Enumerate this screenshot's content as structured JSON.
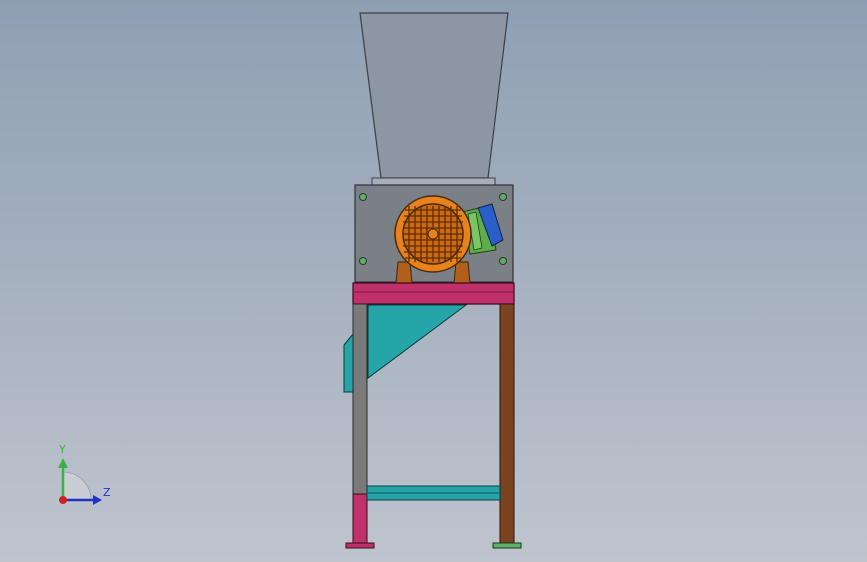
{
  "viewport": {
    "background_top": "#8f9fb3",
    "background_bottom": "#bfc5cf"
  },
  "model": {
    "hopper_color": "#8d96a4",
    "housing_color": "#7b7f86",
    "motor_color": "#e8821c",
    "motor_fan_guard": "grid",
    "gearbox_colors": [
      "#5fae4a",
      "#2a5fc8"
    ],
    "top_rail_color": "#c0306a",
    "leg_color_left": "#7a7a7a",
    "leg_color_right": "#7a4420",
    "brace_color": "#25a5a8",
    "foot_colors": [
      "#c0306a",
      "#5fae6a"
    ]
  },
  "triad": {
    "y_label": "Y",
    "z_label": "Z",
    "y_color": "#3cb043",
    "z_color": "#2233cc",
    "origin_color": "#d02020"
  }
}
